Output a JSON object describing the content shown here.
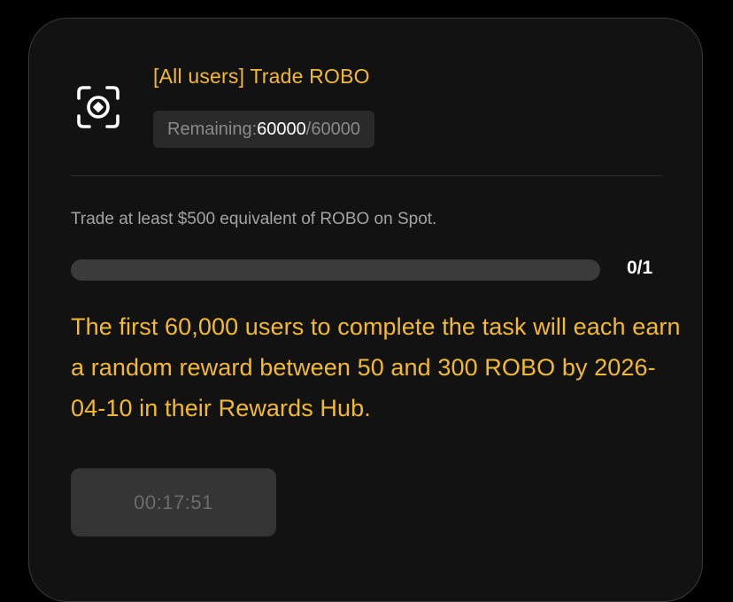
{
  "task": {
    "title": "[All users] Trade ROBO",
    "icon": "scan-token-icon",
    "remaining": {
      "prefix": "Remaining: ",
      "current": "60000",
      "total": "/60000"
    },
    "description": "Trade at least $500 equivalent of ROBO on Spot.",
    "progress": {
      "text": "0/1",
      "fraction": 0
    },
    "reward_text": "The first 60,000 users to complete the task will each earn a random reward between 50 and 300 ROBO by 2026-04-10 in their Rewards Hub.",
    "countdown": "00:17:51"
  },
  "colors": {
    "accent": "#F3BA2F",
    "card_bg": "#121212",
    "card_border": "#3a3a3a",
    "badge_bg": "#2a2a2a",
    "progress_track": "#3b3b3b",
    "button_bg": "#353535",
    "button_text": "#6b6b6b"
  }
}
